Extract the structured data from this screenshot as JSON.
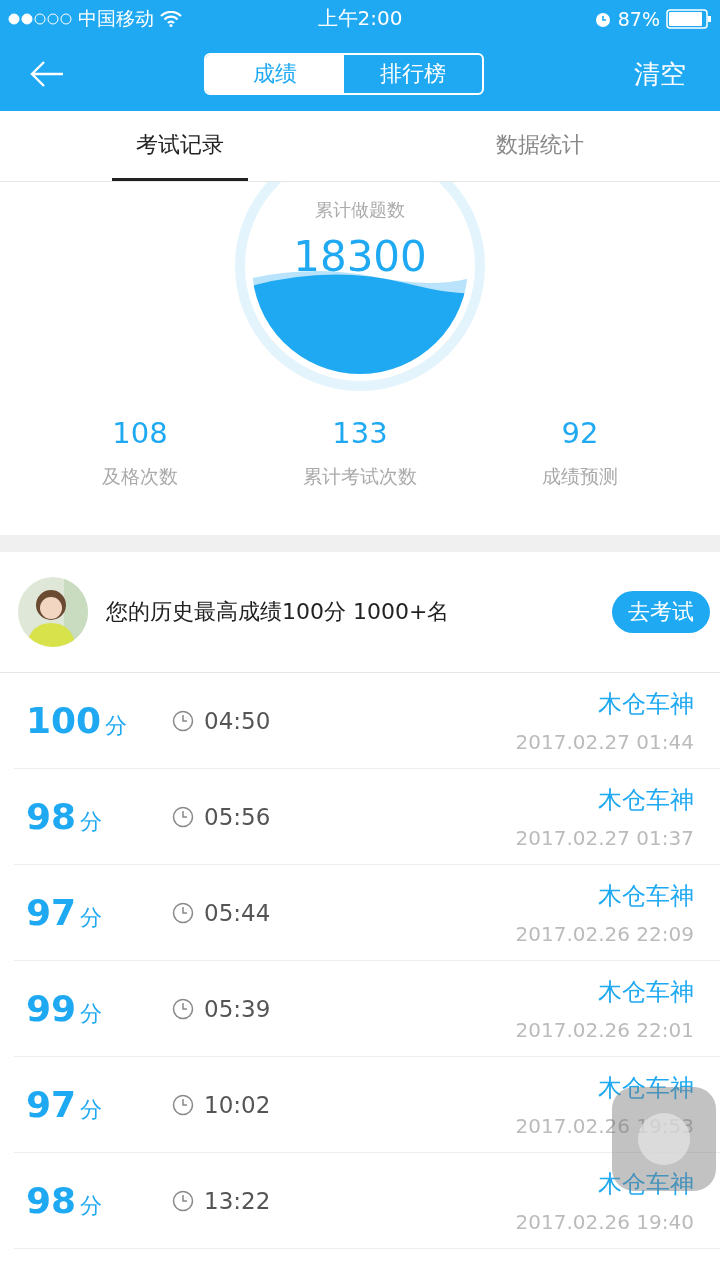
{
  "status_bar": {
    "carrier": "中国移动",
    "time": "上午2:00",
    "battery": "87%"
  },
  "nav": {
    "segments": [
      {
        "label": "成绩",
        "selected": true
      },
      {
        "label": "排行榜",
        "selected": false
      }
    ],
    "action": "清空"
  },
  "tabs": [
    {
      "label": "考试记录",
      "selected": true
    },
    {
      "label": "数据统计",
      "selected": false
    }
  ],
  "gauge": {
    "caption": "累计做题数",
    "value": "18300"
  },
  "stats": [
    {
      "value": "108",
      "label": "及格次数"
    },
    {
      "value": "133",
      "label": "累计考试次数"
    },
    {
      "value": "92",
      "label": "成绩预测"
    }
  ],
  "best": {
    "text": "您的历史最高成绩100分 1000+名",
    "button": "去考试"
  },
  "records": [
    {
      "score": "100",
      "unit": "分",
      "duration": "04:50",
      "name": "木仓车神",
      "date": "2017.02.27 01:44"
    },
    {
      "score": "98",
      "unit": "分",
      "duration": "05:56",
      "name": "木仓车神",
      "date": "2017.02.27 01:37"
    },
    {
      "score": "97",
      "unit": "分",
      "duration": "05:44",
      "name": "木仓车神",
      "date": "2017.02.26 22:09"
    },
    {
      "score": "99",
      "unit": "分",
      "duration": "05:39",
      "name": "木仓车神",
      "date": "2017.02.26 22:01"
    },
    {
      "score": "97",
      "unit": "分",
      "duration": "10:02",
      "name": "木仓车神",
      "date": "2017.02.26 19:53"
    },
    {
      "score": "98",
      "unit": "分",
      "duration": "13:22",
      "name": "木仓车神",
      "date": "2017.02.26 19:40"
    }
  ]
}
